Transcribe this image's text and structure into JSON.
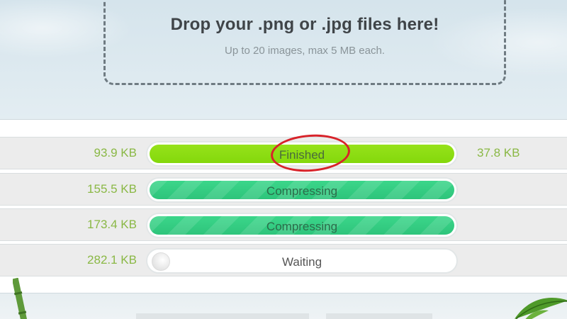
{
  "dropzone": {
    "title": "Drop your .png or .jpg files here!",
    "subtitle": "Up to 20 images, max 5 MB each."
  },
  "files": [
    {
      "original_size": "93.9 KB",
      "status": "Finished",
      "state": "finished",
      "result_size": "37.8 KB"
    },
    {
      "original_size": "155.5 KB",
      "status": "Compressing",
      "state": "compressing",
      "result_size": ""
    },
    {
      "original_size": "173.4 KB",
      "status": "Compressing",
      "state": "compressing",
      "result_size": ""
    },
    {
      "original_size": "282.1 KB",
      "status": "Waiting",
      "state": "waiting",
      "result_size": ""
    }
  ],
  "colors": {
    "finished": "#8bdc10",
    "compressing": "#34cd82",
    "size_text": "#8ab845",
    "annotation_ring": "#d8232a"
  }
}
